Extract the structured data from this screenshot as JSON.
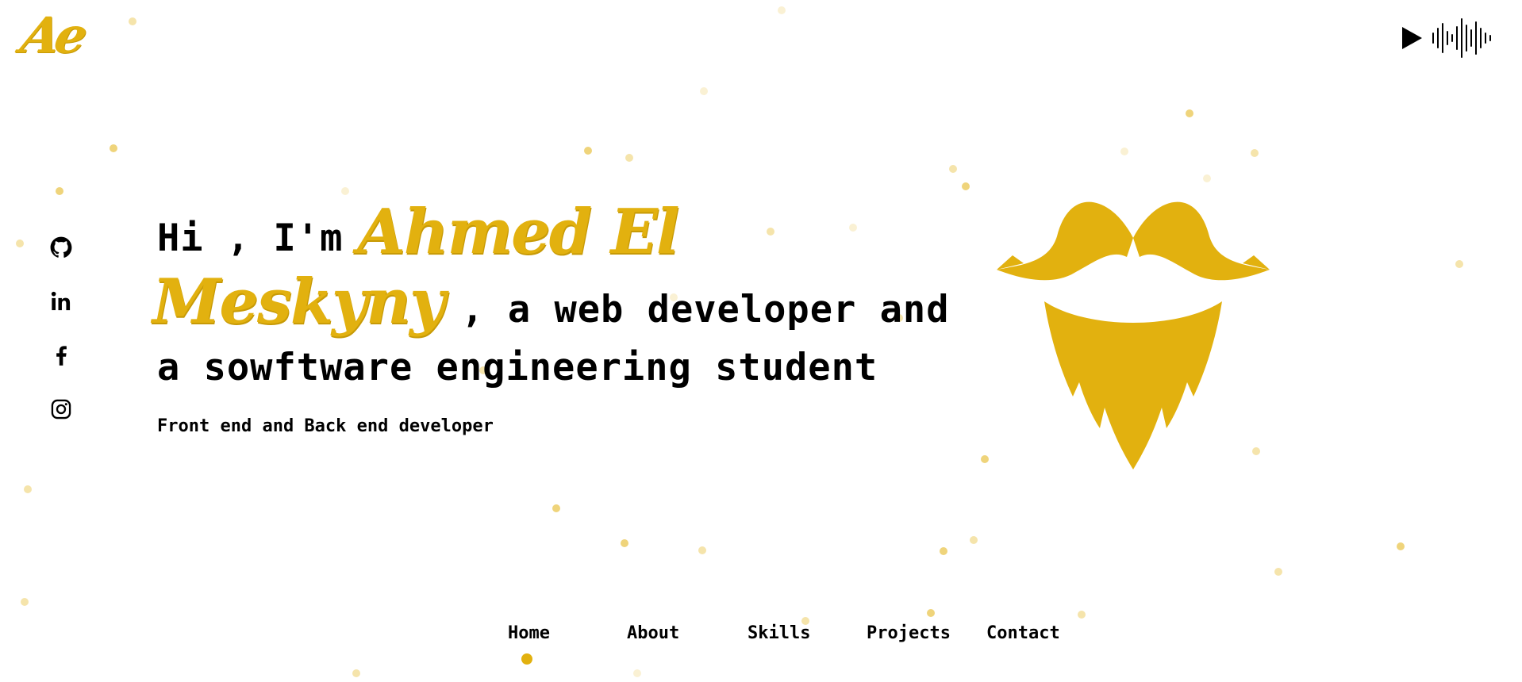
{
  "brand": {
    "logo_text": "Ae",
    "accent_color": "#e2b10f",
    "text_color": "#000000"
  },
  "audio": {
    "play_icon": "play-icon",
    "waveform_icon": "waveform-icon"
  },
  "socials": [
    {
      "icon": "github-icon"
    },
    {
      "icon": "linkedin-icon"
    },
    {
      "icon": "facebook-icon"
    },
    {
      "icon": "instagram-icon"
    }
  ],
  "hero": {
    "greeting": "Hi , I'm",
    "name_first": "Ahmed El",
    "name_last": "Meskyny",
    "after_name": ", a web developer and",
    "line3": "a sowftware engineering student",
    "subtitle": "Front end and Back end developer",
    "illustration_icon": "beard-icon"
  },
  "nav": {
    "items": [
      {
        "label": "Home",
        "active": true
      },
      {
        "label": "About",
        "active": false
      },
      {
        "label": "Skills",
        "active": false
      },
      {
        "label": "Projects",
        "active": false
      },
      {
        "label": "Contact",
        "active": false
      }
    ]
  }
}
